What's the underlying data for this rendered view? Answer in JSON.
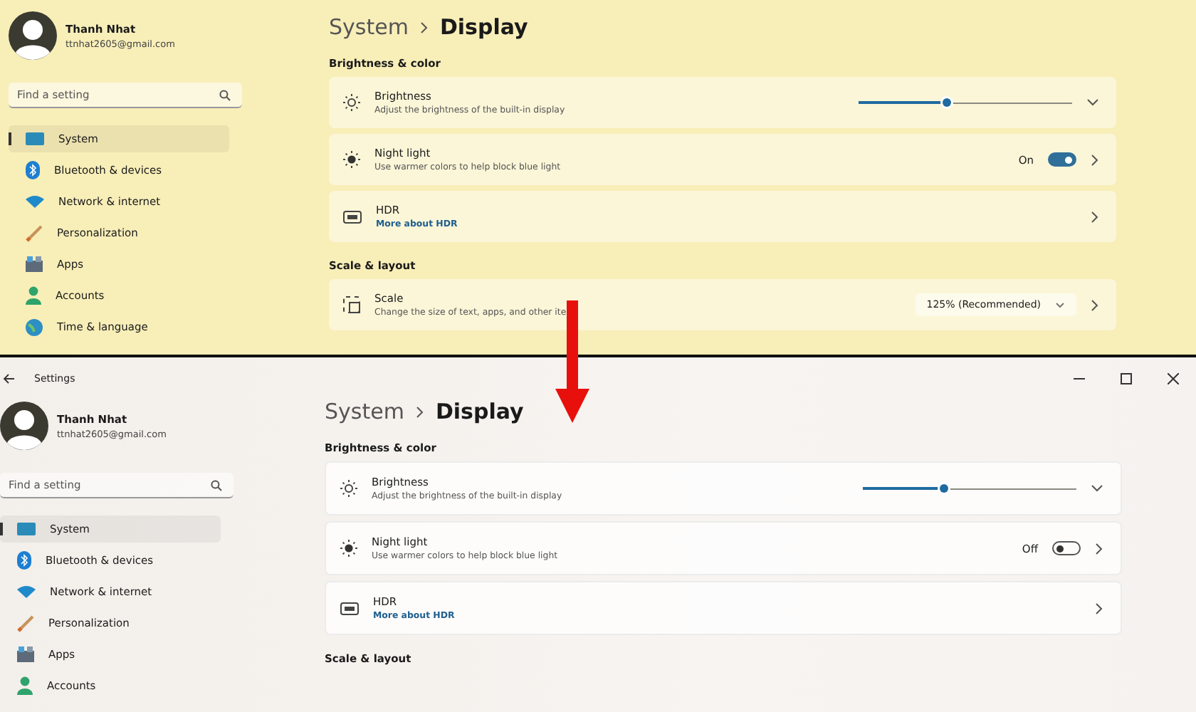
{
  "panels": [
    {
      "tinted": true,
      "user": {
        "name": "Thanh Nhat",
        "email": "ttnhat2605@gmail.com"
      },
      "search": {
        "placeholder": "Find a setting"
      },
      "nav": [
        {
          "label": "System",
          "selected": true
        },
        {
          "label": "Bluetooth & devices",
          "selected": false
        },
        {
          "label": "Network & internet",
          "selected": false
        },
        {
          "label": "Personalization",
          "selected": false
        },
        {
          "label": "Apps",
          "selected": false
        },
        {
          "label": "Accounts",
          "selected": false
        },
        {
          "label": "Time & language",
          "selected": false
        }
      ],
      "breadcrumb": {
        "parent": "System",
        "current": "Display"
      },
      "sections": [
        {
          "heading": "Brightness & color",
          "rows": [
            {
              "kind": "slider",
              "title": "Brightness",
              "subtitle": "Adjust the brightness of the built-in display",
              "level": 0.41
            },
            {
              "kind": "toggle",
              "title": "Night light",
              "subtitle": "Use warmer colors to help block blue light",
              "state_label": "On",
              "on": true
            },
            {
              "kind": "link",
              "title": "HDR",
              "link": "More about HDR"
            }
          ]
        },
        {
          "heading": "Scale & layout",
          "rows": [
            {
              "kind": "dropdown",
              "title": "Scale",
              "subtitle": "Change the size of text, apps, and other ite",
              "value": "125% (Recommended)"
            }
          ]
        }
      ]
    },
    {
      "tinted": false,
      "title_bar": {
        "title": "Settings"
      },
      "user": {
        "name": "Thanh Nhat",
        "email": "ttnhat2605@gmail.com"
      },
      "search": {
        "placeholder": "Find a setting"
      },
      "nav": [
        {
          "label": "System",
          "selected": true
        },
        {
          "label": "Bluetooth & devices",
          "selected": false
        },
        {
          "label": "Network & internet",
          "selected": false
        },
        {
          "label": "Personalization",
          "selected": false
        },
        {
          "label": "Apps",
          "selected": false
        },
        {
          "label": "Accounts",
          "selected": false
        }
      ],
      "breadcrumb": {
        "parent": "System",
        "current": "Display"
      },
      "sections": [
        {
          "heading": "Brightness & color",
          "rows": [
            {
              "kind": "slider",
              "title": "Brightness",
              "subtitle": "Adjust the brightness of the built-in display",
              "level": 0.38
            },
            {
              "kind": "toggle",
              "title": "Night light",
              "subtitle": "Use warmer colors to help block blue light",
              "state_label": "Off",
              "on": false
            },
            {
              "kind": "link",
              "title": "HDR",
              "link": "More about HDR"
            }
          ]
        },
        {
          "heading": "Scale & layout"
        }
      ]
    }
  ]
}
